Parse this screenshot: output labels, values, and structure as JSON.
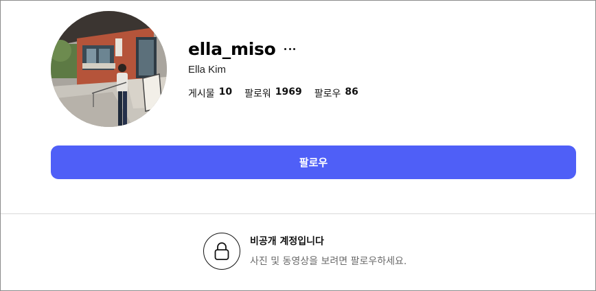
{
  "profile": {
    "username": "ella_miso",
    "full_name": "Ella Kim",
    "more_label": "···"
  },
  "stats": [
    {
      "label": "게시물",
      "value": "10"
    },
    {
      "label": "팔로워",
      "value": "1969"
    },
    {
      "label": "팔로우",
      "value": "86"
    }
  ],
  "follow_button": {
    "label": "팔로우"
  },
  "private_notice": {
    "title": "비공개 계정입니다",
    "description": "사진 및 동영상을 보려면 팔로우하세요."
  },
  "colors": {
    "accent": "#4f5ff7",
    "text": "#111111",
    "muted": "#6a6a6a",
    "divider": "#d9d9d9"
  },
  "icons": {
    "more": "more-horizontal-icon",
    "lock": "lock-icon"
  }
}
